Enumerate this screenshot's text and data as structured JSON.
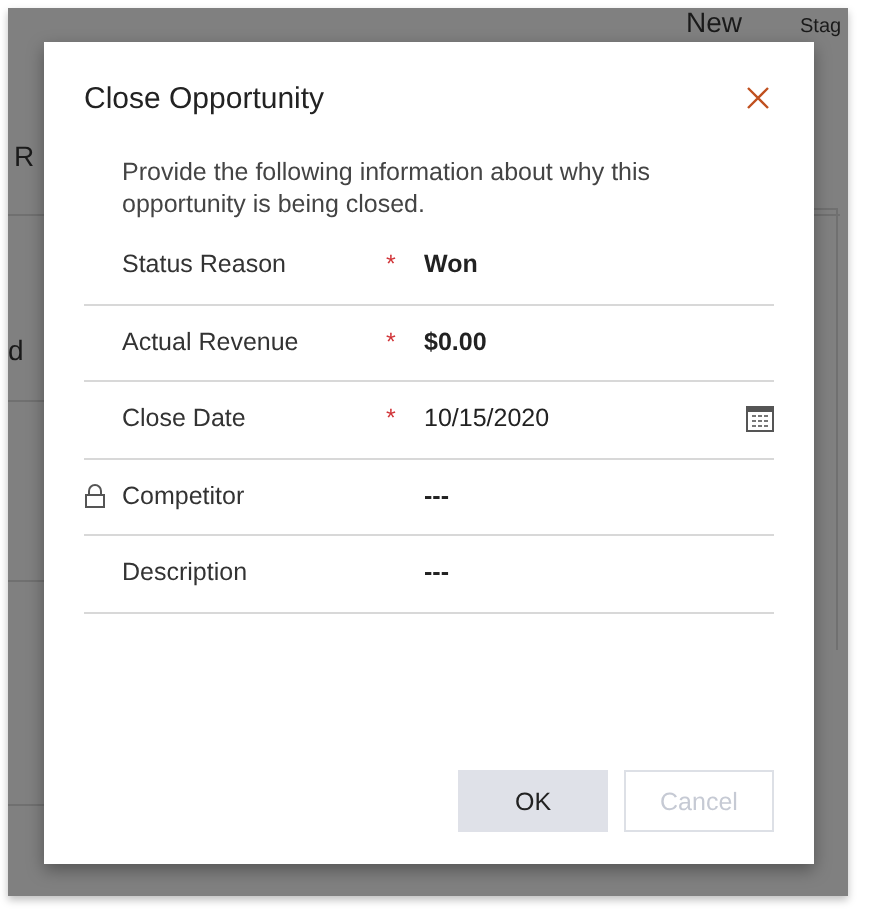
{
  "background_page": {
    "texts": [
      "New",
      "Stag",
      "R",
      "d"
    ]
  },
  "dialog": {
    "title": "Close Opportunity",
    "intro": "Provide the following information about why this opportunity is being closed.",
    "fields": [
      {
        "kind": "text",
        "label": "Status Reason",
        "required_mark": "*",
        "locked": false,
        "value": "Won",
        "bold": true
      },
      {
        "kind": "text",
        "label": "Actual Revenue",
        "required_mark": "*",
        "locked": false,
        "value": "$0.00",
        "bold": true
      },
      {
        "kind": "date",
        "label": "Close Date",
        "required_mark": "*",
        "locked": false,
        "value": "10/15/2020",
        "bold": false
      },
      {
        "kind": "text",
        "label": "Competitor",
        "locked": true,
        "value": "---",
        "bold": true
      },
      {
        "kind": "text",
        "label": "Description",
        "locked": false,
        "value": "---",
        "bold": true
      }
    ],
    "buttons": [
      {
        "label": "OK",
        "disabled": false
      },
      {
        "label": "Cancel",
        "disabled": true
      }
    ]
  }
}
